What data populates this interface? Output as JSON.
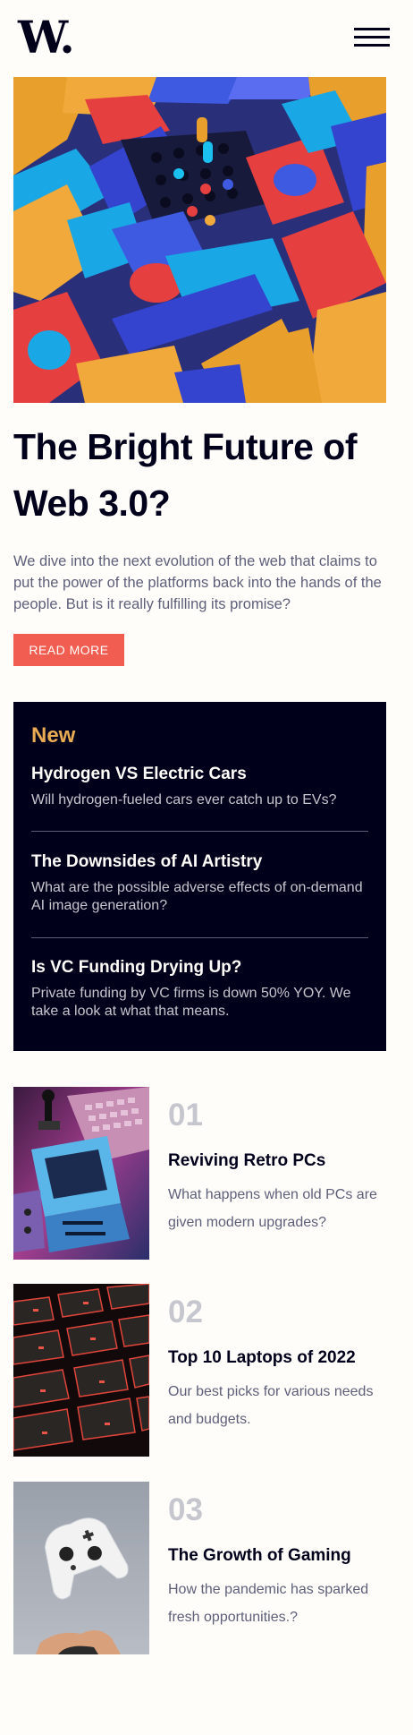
{
  "header": {
    "logo": "W."
  },
  "hero": {
    "title": "The Bright Future of Web 3.0?",
    "description": "We dive into the next evolution of the web that claims to put the power of the platforms back into the hands of the people. But is it really fulfilling its promise?",
    "cta_label": "READ MORE"
  },
  "new_panel": {
    "heading": "New",
    "items": [
      {
        "title": "Hydrogen VS Electric Cars",
        "description": "Will hydrogen-fueled cars ever catch up to EVs?"
      },
      {
        "title": "The Downsides of AI Artistry",
        "description": "What are the possible adverse effects of on-demand AI image generation?"
      },
      {
        "title": "Is VC Funding Drying Up?",
        "description": "Private funding by VC firms is down 50% YOY. We take a look at what that means."
      }
    ]
  },
  "articles": [
    {
      "number": "01",
      "title": "Reviving Retro PCs",
      "description": "What happens when old PCs are given modern upgrades?"
    },
    {
      "number": "02",
      "title": "Top 10 Laptops of 2022",
      "description": "Our best picks for various needs and budgets."
    },
    {
      "number": "03",
      "title": "The Growth of Gaming",
      "description": "How the pandemic has sparked fresh opportunities.?"
    }
  ],
  "icons": {
    "menu": "hamburger-menu-icon"
  },
  "colors": {
    "background": "#fffdfa",
    "dark_navy": "#00001a",
    "accent_red": "#f15d51",
    "accent_orange": "#e9ab53",
    "grayish_blue": "#5d5f79",
    "light_gray": "#c5c6ce"
  }
}
